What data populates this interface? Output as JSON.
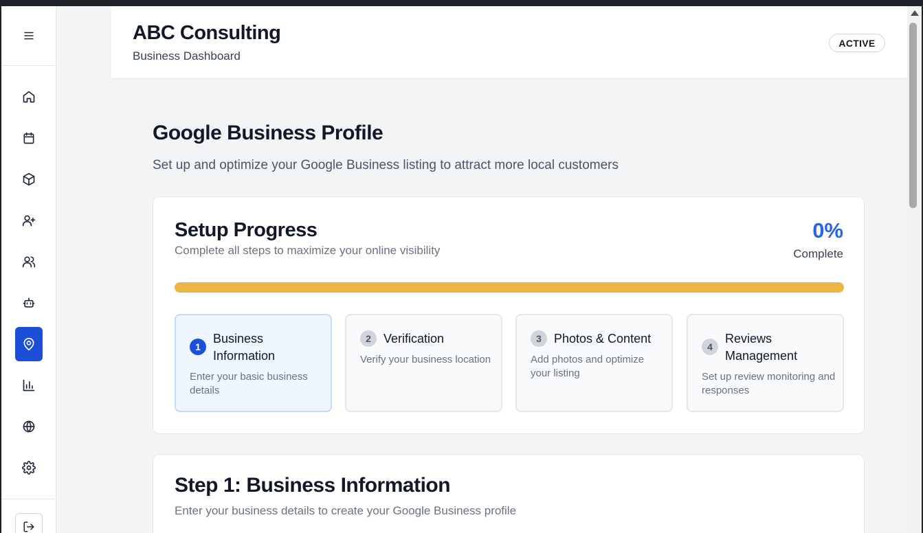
{
  "header": {
    "company": "ABC Consulting",
    "subtitle": "Business Dashboard",
    "status": "ACTIVE"
  },
  "sidebar": {
    "items": [
      {
        "icon": "home-icon",
        "active": false
      },
      {
        "icon": "calendar-icon",
        "active": false
      },
      {
        "icon": "package-icon",
        "active": false
      },
      {
        "icon": "user-plus-icon",
        "active": false
      },
      {
        "icon": "users-icon",
        "active": false
      },
      {
        "icon": "bot-icon",
        "active": false
      },
      {
        "icon": "map-pin-icon",
        "active": true
      },
      {
        "icon": "bar-chart-icon",
        "active": false
      },
      {
        "icon": "globe-icon",
        "active": false
      },
      {
        "icon": "settings-icon",
        "active": false
      }
    ],
    "logout_icon": "logout-icon",
    "menu_icon": "menu-icon"
  },
  "page": {
    "title": "Google Business Profile",
    "description": "Set up and optimize your Google Business listing to attract more local customers"
  },
  "progress": {
    "title": "Setup Progress",
    "subtitle": "Complete all steps to maximize your online visibility",
    "percent_text": "0%",
    "percent_label": "Complete",
    "value": 0,
    "bar_color": "#eab545"
  },
  "steps": [
    {
      "number": "1",
      "name": "Business Information",
      "description": "Enter your basic business details",
      "active": true
    },
    {
      "number": "2",
      "name": "Verification",
      "description": "Verify your business location",
      "active": false
    },
    {
      "number": "3",
      "name": "Photos & Content",
      "description": "Add photos and optimize your listing",
      "active": false
    },
    {
      "number": "4",
      "name": "Reviews Management",
      "description": "Set up review monitoring and responses",
      "active": false
    }
  ],
  "step_section": {
    "heading": "Step 1: Business Information",
    "text": "Enter your business details to create your Google Business profile"
  },
  "colors": {
    "accent": "#1d4ed8",
    "percent": "#2563eb"
  }
}
